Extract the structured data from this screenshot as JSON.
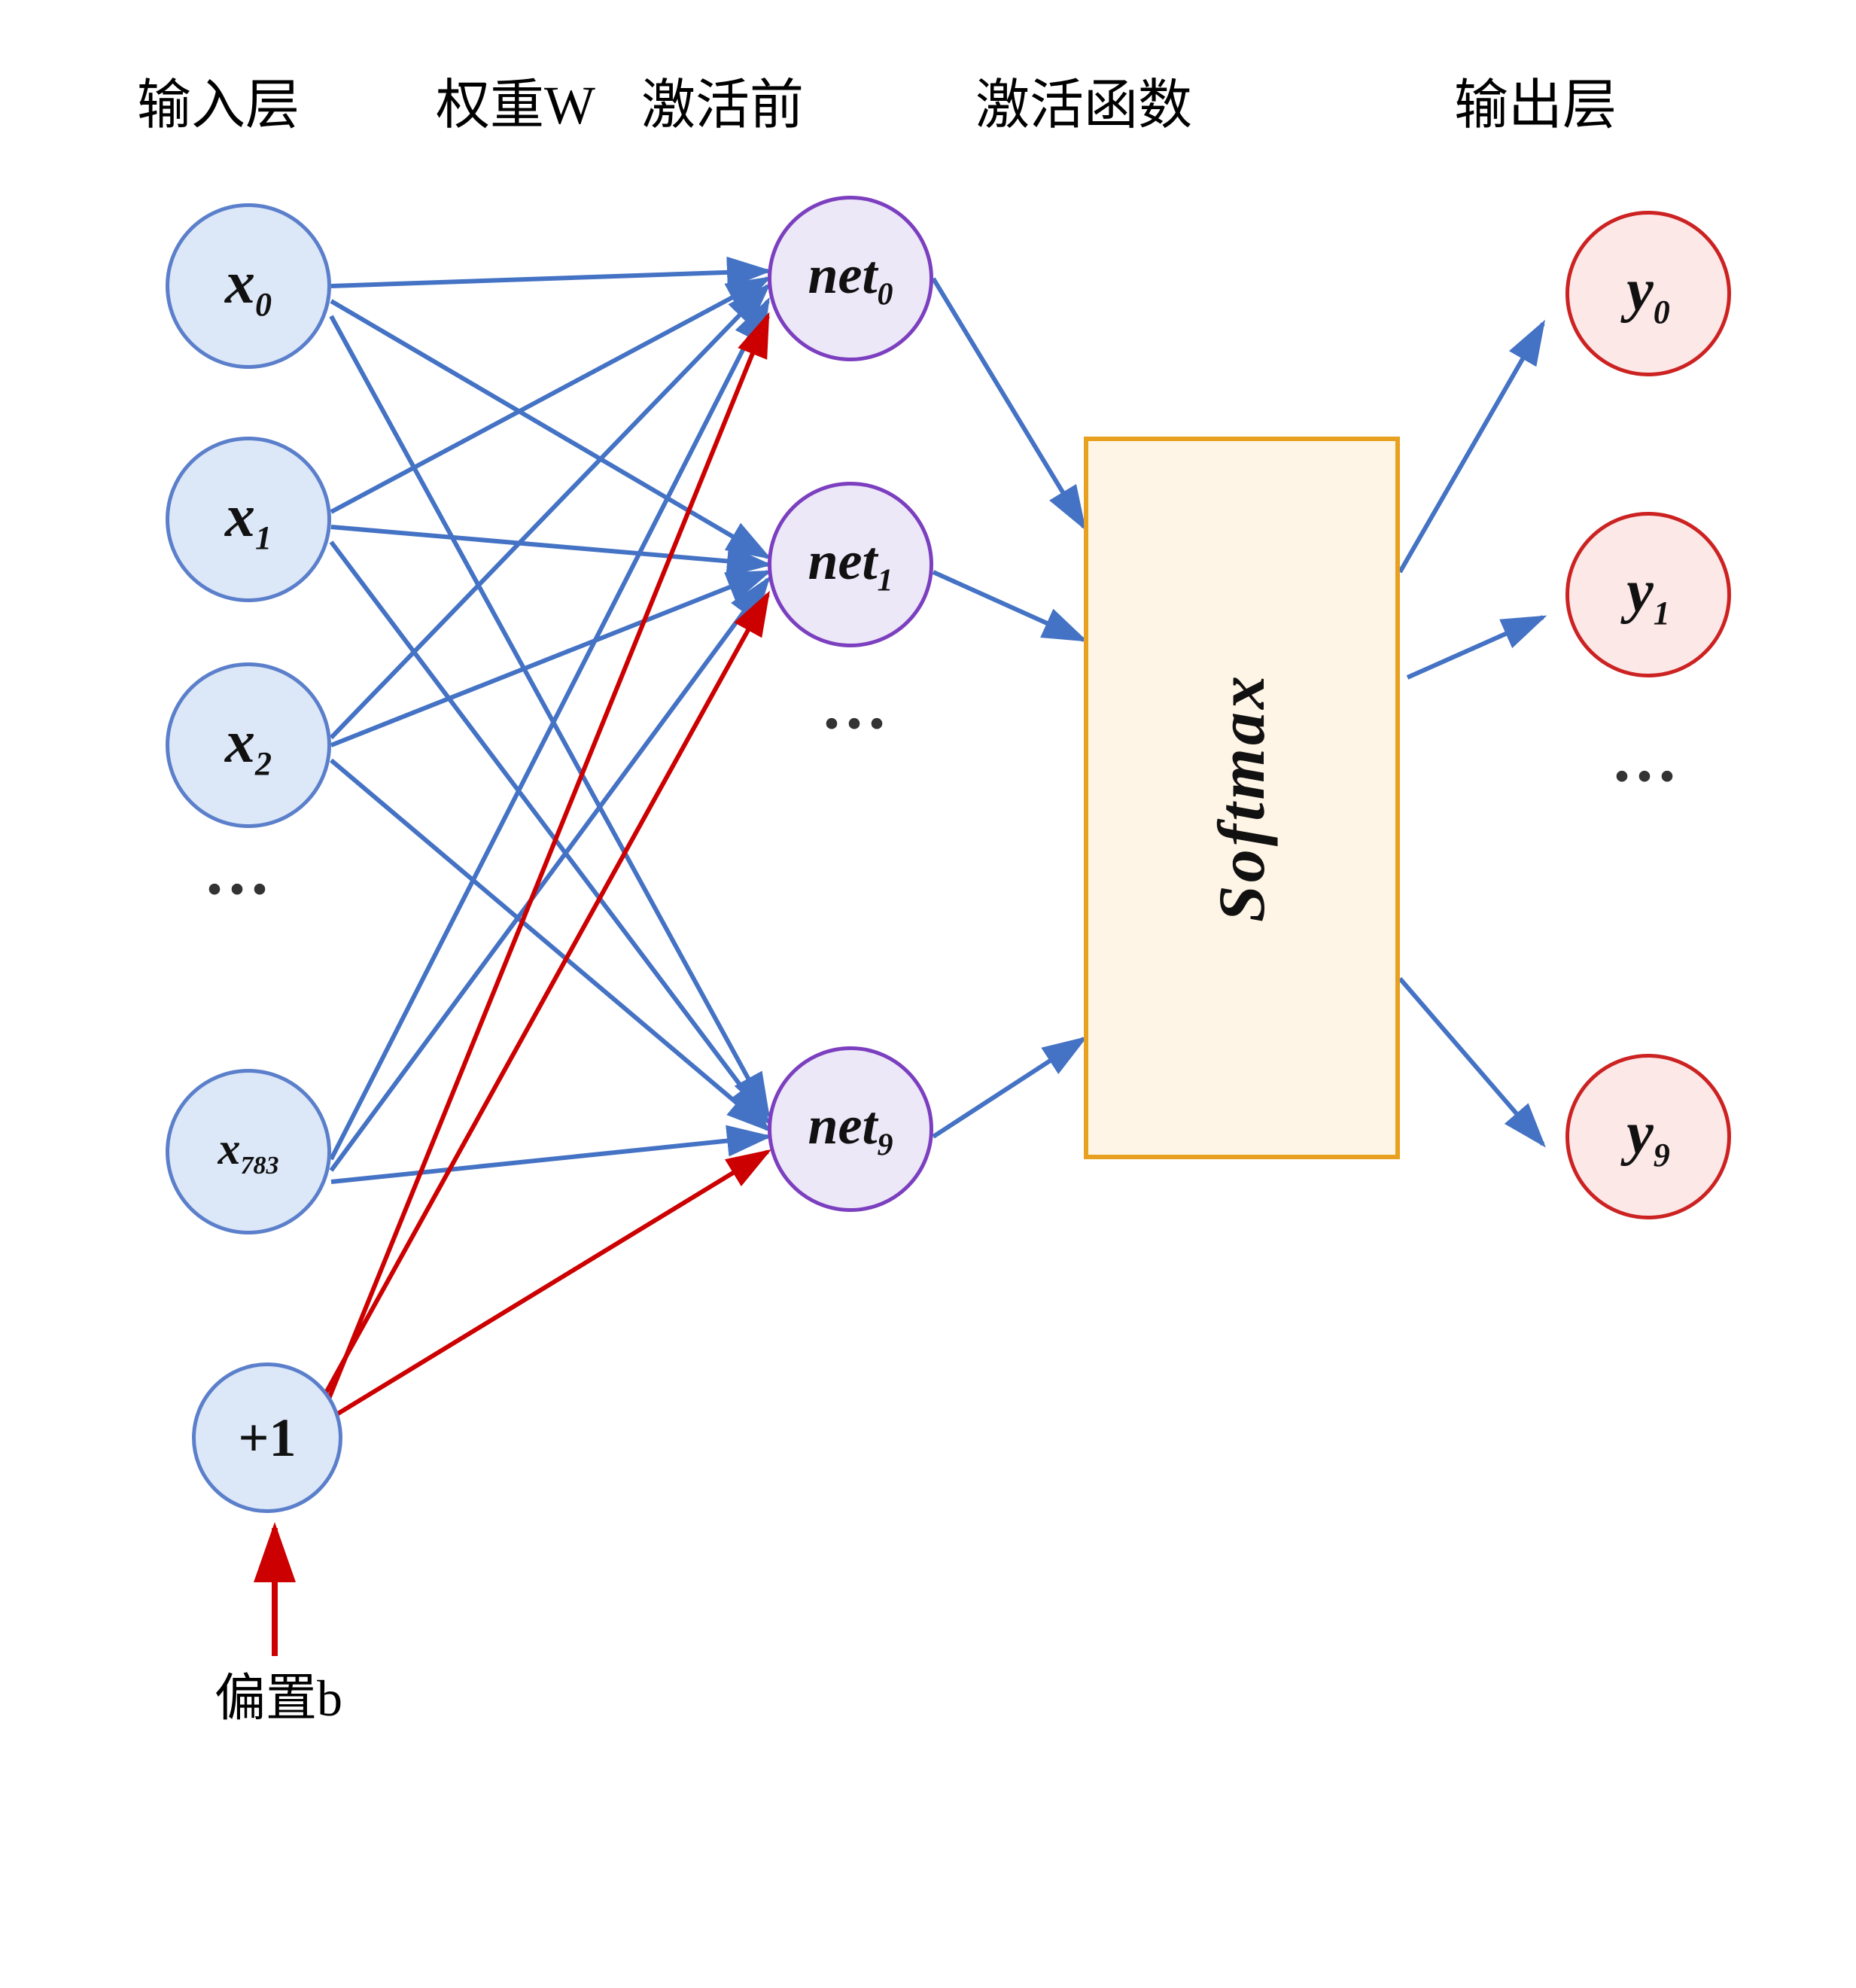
{
  "labels": {
    "input_layer": "输入层",
    "weight": "权重W",
    "pre_activation": "激活前",
    "activation_func": "激活函数",
    "output_layer": "输出层",
    "softmax": "Softmax",
    "bias": "偏置b"
  },
  "colors": {
    "blue": "#4472c4",
    "red": "#cc0000",
    "orange": "#e8a020",
    "purple": "#7b3fbf",
    "input_fill": "#dce8f8",
    "input_stroke": "#5b7fcb",
    "hidden_fill": "#ece8f8",
    "hidden_stroke": "#7b3fbf",
    "output_fill": "#fde8e8",
    "output_stroke": "#cc2222"
  },
  "input_nodes": [
    "x_0",
    "x_1",
    "x_2",
    "...",
    "x_{783}",
    "+1"
  ],
  "hidden_nodes": [
    "net_0",
    "net_1",
    "...",
    "net_9"
  ],
  "output_nodes": [
    "y_0",
    "y_1",
    "...",
    "y_9"
  ]
}
